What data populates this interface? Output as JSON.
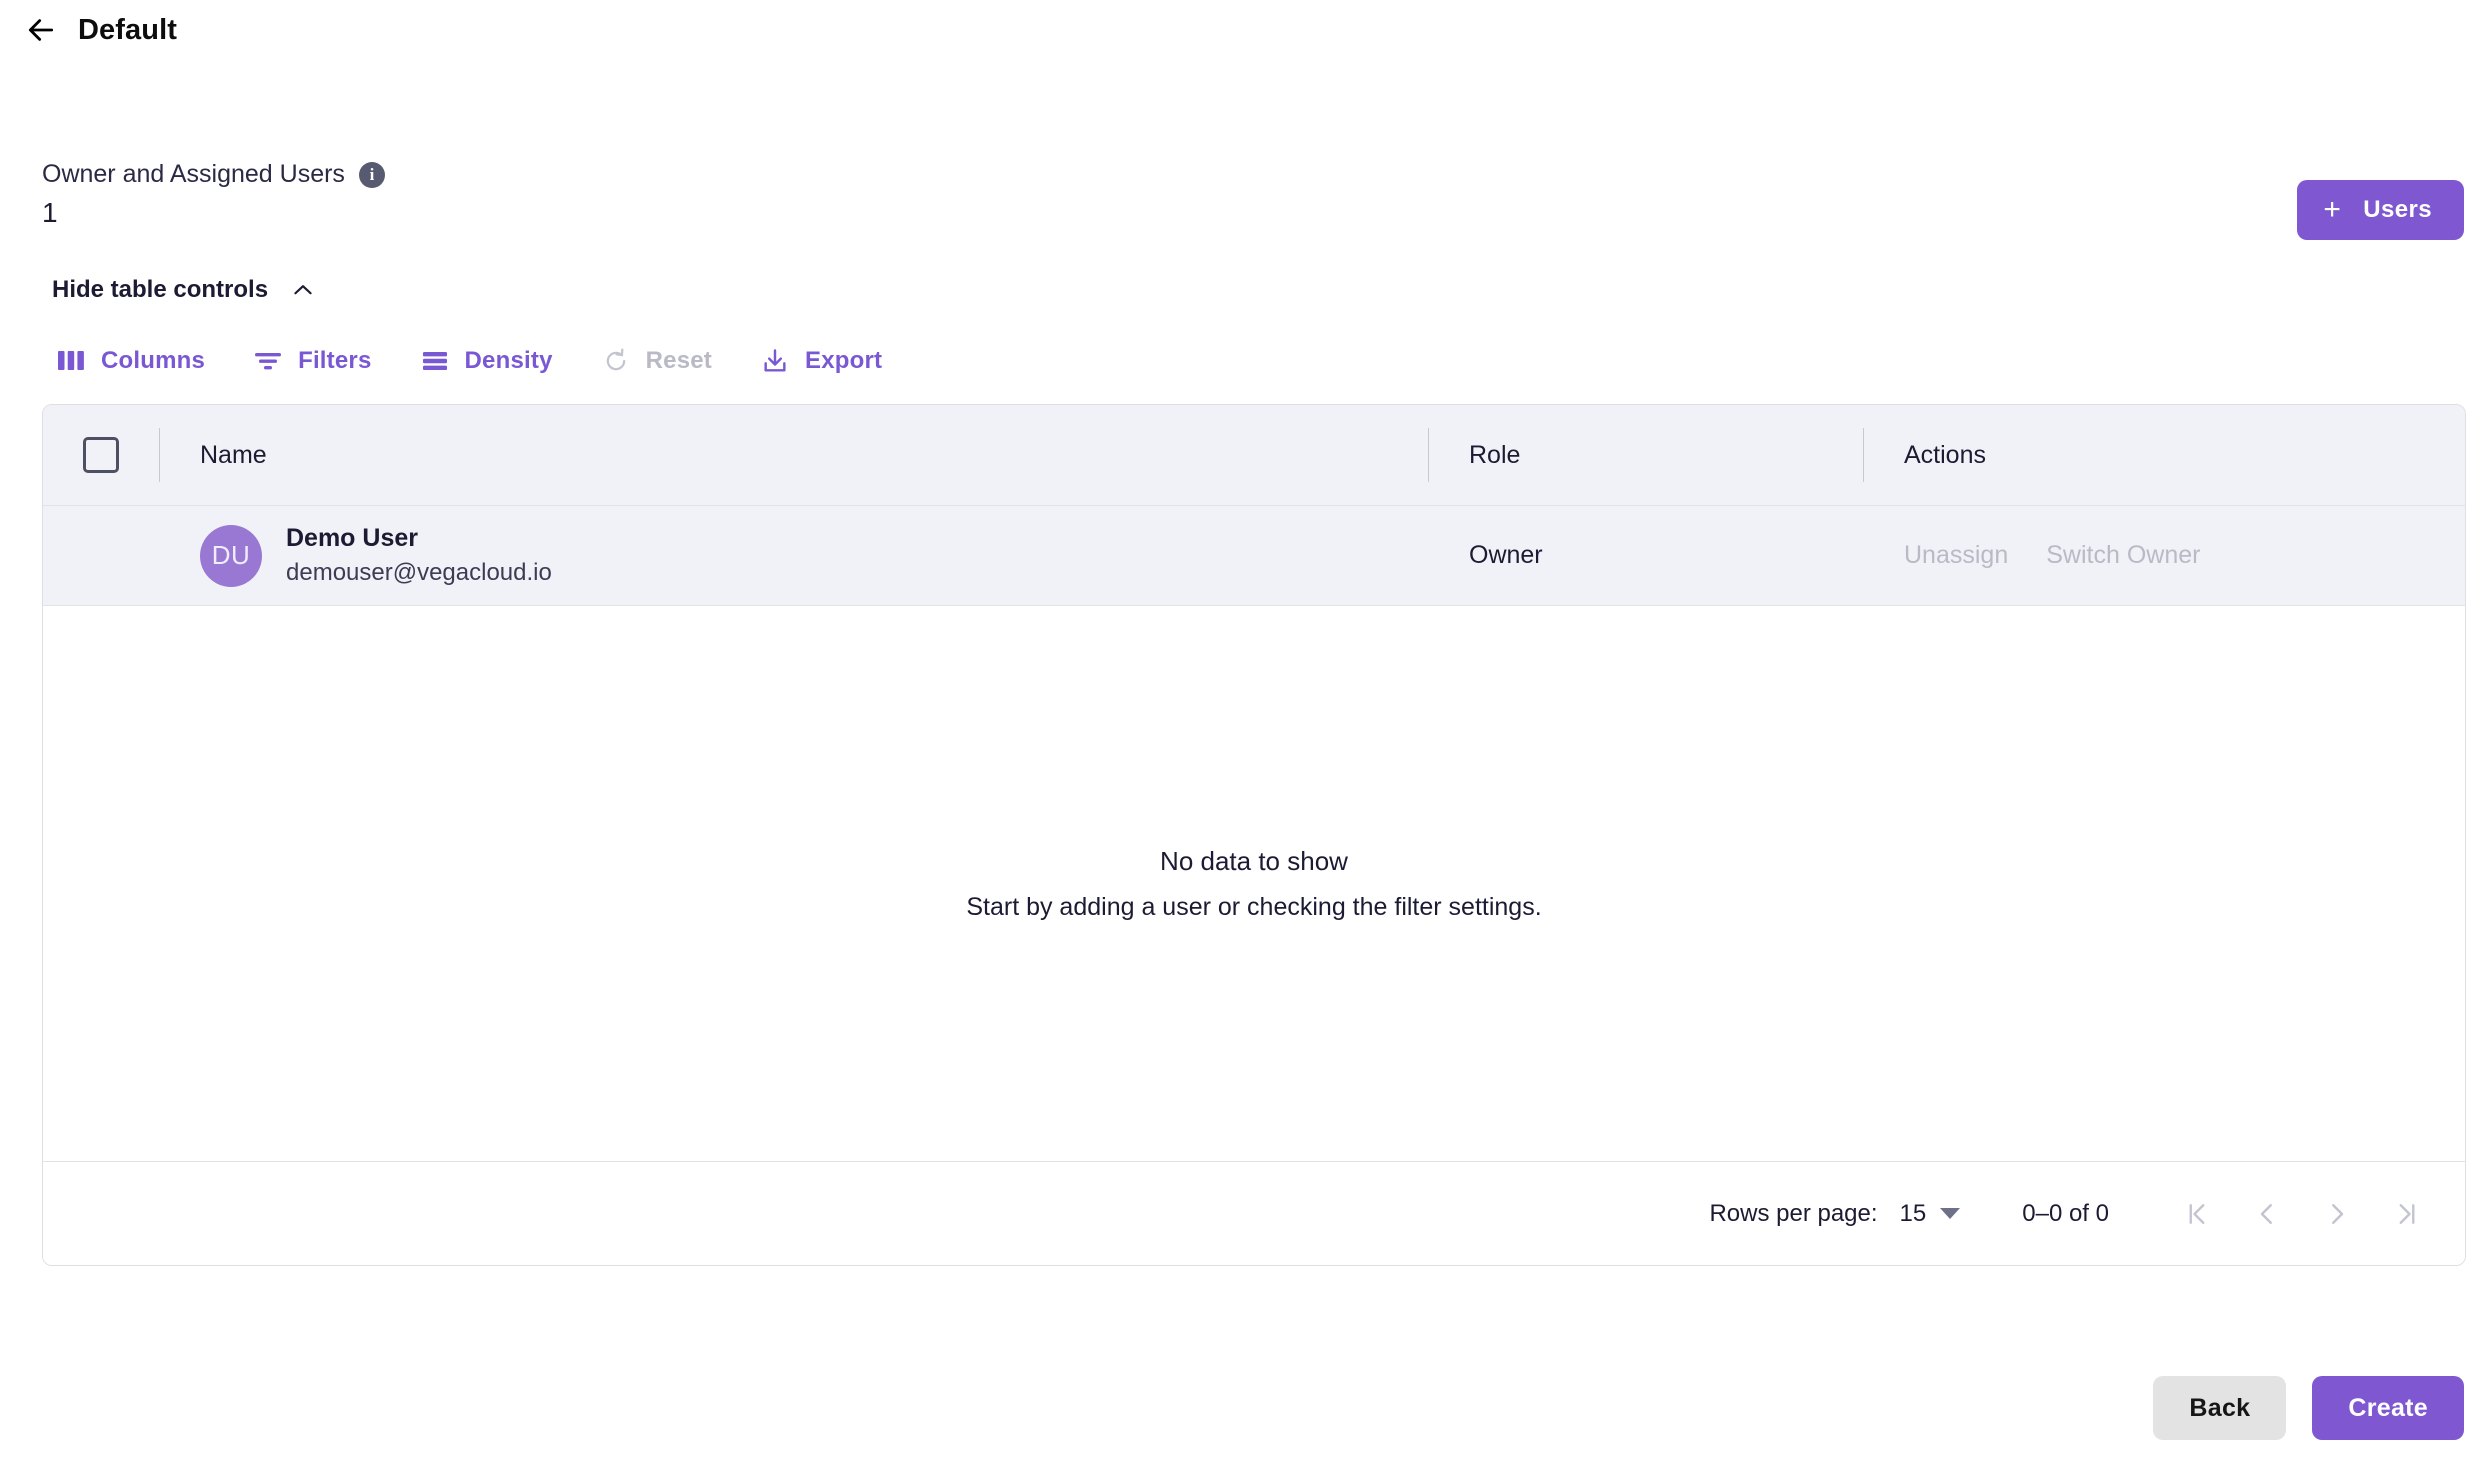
{
  "header": {
    "back_icon": "arrow-left-icon",
    "title": "Default"
  },
  "summary": {
    "label": "Owner and Assigned Users",
    "info_icon": "info-icon",
    "count": "1"
  },
  "add_users_button": {
    "plus": "+",
    "label": "Users"
  },
  "table_controls": {
    "toggle_label": "Hide table controls",
    "toggle_icon": "chevron-up-icon",
    "buttons": [
      {
        "label": "Columns",
        "icon": "columns-icon",
        "disabled": false
      },
      {
        "label": "Filters",
        "icon": "filters-icon",
        "disabled": false
      },
      {
        "label": "Density",
        "icon": "density-icon",
        "disabled": false
      },
      {
        "label": "Reset",
        "icon": "reset-icon",
        "disabled": true
      },
      {
        "label": "Export",
        "icon": "export-icon",
        "disabled": false
      }
    ]
  },
  "table": {
    "columns": [
      "Name",
      "Role",
      "Actions"
    ],
    "rows": [
      {
        "avatar_initials": "DU",
        "name": "Demo User",
        "email": "demouser@vegacloud.io",
        "role": "Owner",
        "actions": [
          "Unassign",
          "Switch Owner"
        ]
      }
    ],
    "empty_state": {
      "title": "No data to show",
      "subtitle": "Start by adding a user or checking the filter settings."
    }
  },
  "pagination": {
    "rows_per_page_label": "Rows per page:",
    "rows_per_page_value": "15",
    "range": "0–0 of 0",
    "first_icon": "first-page-icon",
    "prev_icon": "previous-page-icon",
    "next_icon": "next-page-icon",
    "last_icon": "last-page-icon"
  },
  "footer_actions": {
    "back": "Back",
    "create": "Create"
  },
  "colors": {
    "accent_purple": "#7e57d1",
    "toolbar_purple": "#7a58d4",
    "avatar_purple": "#9978d4",
    "disabled_gray": "#b9bac5",
    "row_bg": "#f1f2f7",
    "text_dark": "#1c1b33",
    "back_button_bg": "#e3e3e3"
  }
}
